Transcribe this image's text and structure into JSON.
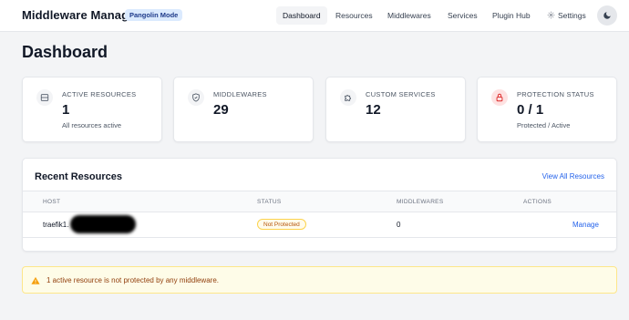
{
  "header": {
    "title": "Middleware Manager",
    "mode_badge": "Pangolin Mode",
    "nav": [
      "Dashboard",
      "Resources",
      "Middlewares",
      "Services",
      "Plugin Hub",
      "Settings"
    ],
    "active_nav": "Dashboard",
    "theme_toggle_icon": "moon-icon"
  },
  "page": {
    "title": "Dashboard"
  },
  "stats": [
    {
      "label": "Active Resources",
      "value": "1",
      "sub": "All resources active",
      "icon": "server-icon"
    },
    {
      "label": "Middlewares",
      "value": "29",
      "sub": "",
      "icon": "shield-icon"
    },
    {
      "label": "Custom Services",
      "value": "12",
      "sub": "",
      "icon": "puzzle-icon"
    },
    {
      "label": "Protection Status",
      "value": "0 / 1",
      "sub": "Protected / Active",
      "icon": "lock-icon",
      "accent": "#dc2626"
    }
  ],
  "recent": {
    "title": "Recent Resources",
    "view_all": "View All Resources",
    "columns": [
      "Host",
      "Status",
      "Middlewares",
      "Actions"
    ],
    "rows": [
      {
        "host": "traefik1.",
        "status": "Not Protected",
        "middlewares": "0",
        "action": "Manage"
      }
    ]
  },
  "warning": {
    "icon": "warning-icon",
    "text": "1 active resource is not protected by any middleware."
  },
  "colors": {
    "accent": "#2563eb",
    "warning": "#f59e0b",
    "danger": "#dc2626"
  }
}
